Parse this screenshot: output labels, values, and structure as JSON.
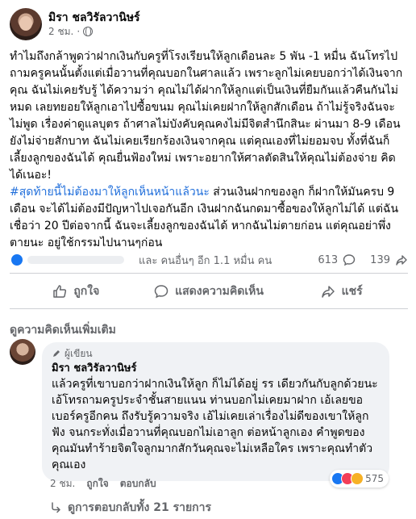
{
  "post": {
    "author": "มิรา ชลวิรัลวานิษร์",
    "time": "2 ชม.",
    "text_before_hashtag": "ทำไมถึงกล้าพูดว่าฝากเงินกับครูที่โรงเรียนให้ลูกเดือนละ 5 พัน -1 หมื่น ฉันโทรไปถามครูคนนั้นตั้งแต่เมื่อวานที่คุณบอกในศาลแล้ว เพราะลูกไม่เคยบอกว่าได้เงินจากคุณ ฉันไม่เคยรับรู้ ได้ความว่า คุณไม่ได้ฝากให้ลูกแต่เป็นเงินที่ยืมกันแล้วคืนกันไม่หมด เลยทยอยให้ลูกเอาไปซื้อขนม คุณไม่เคยฝากให้ลูกสักเดือน ถ้าไม่รู้จริงฉันจะไม่พูด เรื่องค่าดูแลบุตร ถ้าศาลไม่บังคับคุณคงไม่มีจิตสำนึกสินะ ผ่านมา 8-9 เดือนยังไม่จ่ายสักบาท ฉันไม่เคยเรียกร้องเงินจากคุณ แต่คุณเองที่ไม่ยอมจบ ทั้งที่ฉันก็เลี้ยงลูกของฉันได้ คุณยื่นฟ้องใหม่ เพราะอยากให้ศาลตัดสินให้คุณไม่ต้องจ่าย คิดได้เนอะ!",
    "hashtag": "#สุดท้ายนี้ไม่ต้องมาให้ลูกเห็นหน้าแล้วนะ",
    "text_after_hashtag": " ส่วนเงินฝากของลูก ก็ฝากให้มันครบ 9 เดือน จะได้ไม่ต้องมีปัญหาไปเจอกันอีก เงินฝากฉันกดมาซื้อของให้ลูกไม่ได้ แต่ฉันเชื่อว่า 20 ปีต่อจากนี้ ฉันจะเลี้ยงลูกของฉันได้ หากฉันไม่ตายก่อน แต่คุณอย่าพึ่งตายนะ อยู่ใช้กรรมไปนานๆก่อน"
  },
  "reactions": {
    "summary": "และ คนอื่นๆ อีก 1.1 หมื่น คน",
    "comments_count": "613",
    "shares_count": "139"
  },
  "actions": {
    "like": "ถูกใจ",
    "comment": "แสดงความคิดเห็น",
    "share": "แชร์"
  },
  "more_comments": "ดูความคิดเห็นเพิ่มเติม",
  "comment": {
    "badge": "ผู้เขียน",
    "author": "มิรา ชลวิรัลวานิษร์",
    "text": "แล้วครูที่เขาบอกว่าฝากเงินให้ลูก ก็ไม่ได้อยู่ รร เดียวกันกับลูกด้วยนะ เอ้โทรถามครูประจำชั้นสายแนน ท่านบอกไม่เคยมาฝาก เอ้เลยขอเบอร์ครูอีกคน ถึงรับรู้ความจริง เอ้ไม่เคยเล่าเรื่องไม่ดีของเขาให้ลูกฟัง จนกระทั่งเมื่อวานที่คุณบอกไม่เอาลูก ต่อหน้าลูกเอง คำพูดของคุณมันทำร้ายจิตใจลูกมากสักวันคุณจะไม่เหลือใคร เพราะคุณทำตัวคุณเอง",
    "time": "2 ชม.",
    "like": "ถูกใจ",
    "reply": "ตอบกลับ",
    "reaction_count": "575"
  },
  "view_replies": "ดูการตอบกลับทั้ง 21 รายการ",
  "colors": {
    "like_blue": "#1877f2",
    "love_red": "#f33e58",
    "care_yellow": "#f7b125",
    "hashtag": "#216fdb"
  },
  "icons": {
    "comment": "speech-bubble-icon",
    "share": "share-arrow-icon",
    "like": "thumbs-up-icon",
    "globe": "globe-icon"
  }
}
